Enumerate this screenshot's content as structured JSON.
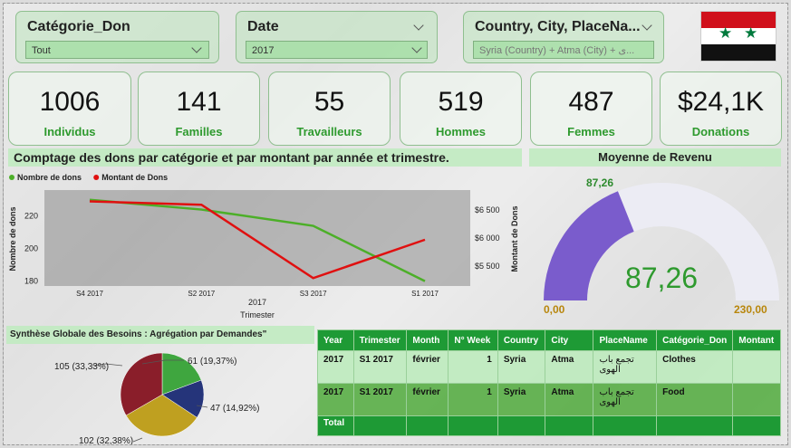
{
  "filters": [
    {
      "label": "Catégorie_Don",
      "value": "Tout"
    },
    {
      "label": "Date",
      "value": "2017"
    },
    {
      "label": "Country, City, PlaceNa...",
      "value": "Syria (Country) + Atma (City) + ی..."
    }
  ],
  "kpis": [
    {
      "value": "1006",
      "caption": "Individus"
    },
    {
      "value": "141",
      "caption": "Familles"
    },
    {
      "value": "55",
      "caption": "Travailleurs"
    },
    {
      "value": "519",
      "caption": "Hommes"
    },
    {
      "value": "487",
      "caption": "Femmes"
    },
    {
      "value": "$24,1K",
      "caption": "Donations"
    }
  ],
  "line_section_title": "Comptage des dons par catégorie et par montant par année et trimestre.",
  "gauge_section_title": "Moyenne de Revenu",
  "pie_section_title": "Synthèse Globale des Besoins : Agrégation par Demandes\"",
  "table": {
    "headers": [
      "Year",
      "Trimester",
      "Month",
      "N° Week",
      "Country",
      "City",
      "PlaceName",
      "Catégorie_Don",
      "Montant"
    ],
    "rows": [
      [
        "2017",
        "S1 2017",
        "février",
        "1",
        "Syria",
        "Atma",
        "تجمع باب الهوى",
        "Clothes",
        ""
      ],
      [
        "2017",
        "S1 2017",
        "février",
        "1",
        "Syria",
        "Atma",
        "تجمع باب الهوى",
        "Food",
        ""
      ]
    ],
    "total_label": "Total"
  },
  "colors": {
    "accent": "#1e9a35",
    "series_count": "#4caf28",
    "series_amount": "#e01010",
    "gauge_fill": "#7a5ccc",
    "gauge_track": "#ececf4"
  },
  "chart_data": [
    {
      "type": "line",
      "legend_position": "top-left",
      "categories": [
        "S4 2017",
        "S2 2017",
        "S3 2017",
        "S1 2017"
      ],
      "x_group_label": "2017",
      "xlabel": "Trimester",
      "ylabel": "Nombre de dons",
      "y2label": "Montant de Dons",
      "ylim": [
        177,
        236
      ],
      "y_ticks": [
        "180",
        "200",
        "220"
      ],
      "y2_ticks": [
        "$5 500",
        "$6 000",
        "$6 500"
      ],
      "series": [
        {
          "name": "Nombre de dons",
          "axis": "left",
          "values": [
            230,
            224,
            214,
            180
          ]
        },
        {
          "name": "Montant de Dons",
          "axis": "right",
          "values": [
            6650,
            6590,
            5290,
            5970
          ]
        }
      ],
      "y2lim": [
        5150,
        6850
      ]
    },
    {
      "type": "gauge",
      "value": 87.26,
      "value_label": "87,26",
      "min_label": "0,00",
      "max_label": "230,00",
      "min": 0,
      "max": 230
    },
    {
      "type": "pie",
      "slices": [
        {
          "label": "61 (19,37%)",
          "value": 61,
          "color": "#3fa63f"
        },
        {
          "label": "47 (14,92%)",
          "value": 47,
          "color": "#25347a"
        },
        {
          "label": "102 (32,38%)",
          "value": 102,
          "color": "#bfa020"
        },
        {
          "label": "105 (33,33%)",
          "value": 105,
          "color": "#8a1e2a"
        }
      ]
    }
  ]
}
